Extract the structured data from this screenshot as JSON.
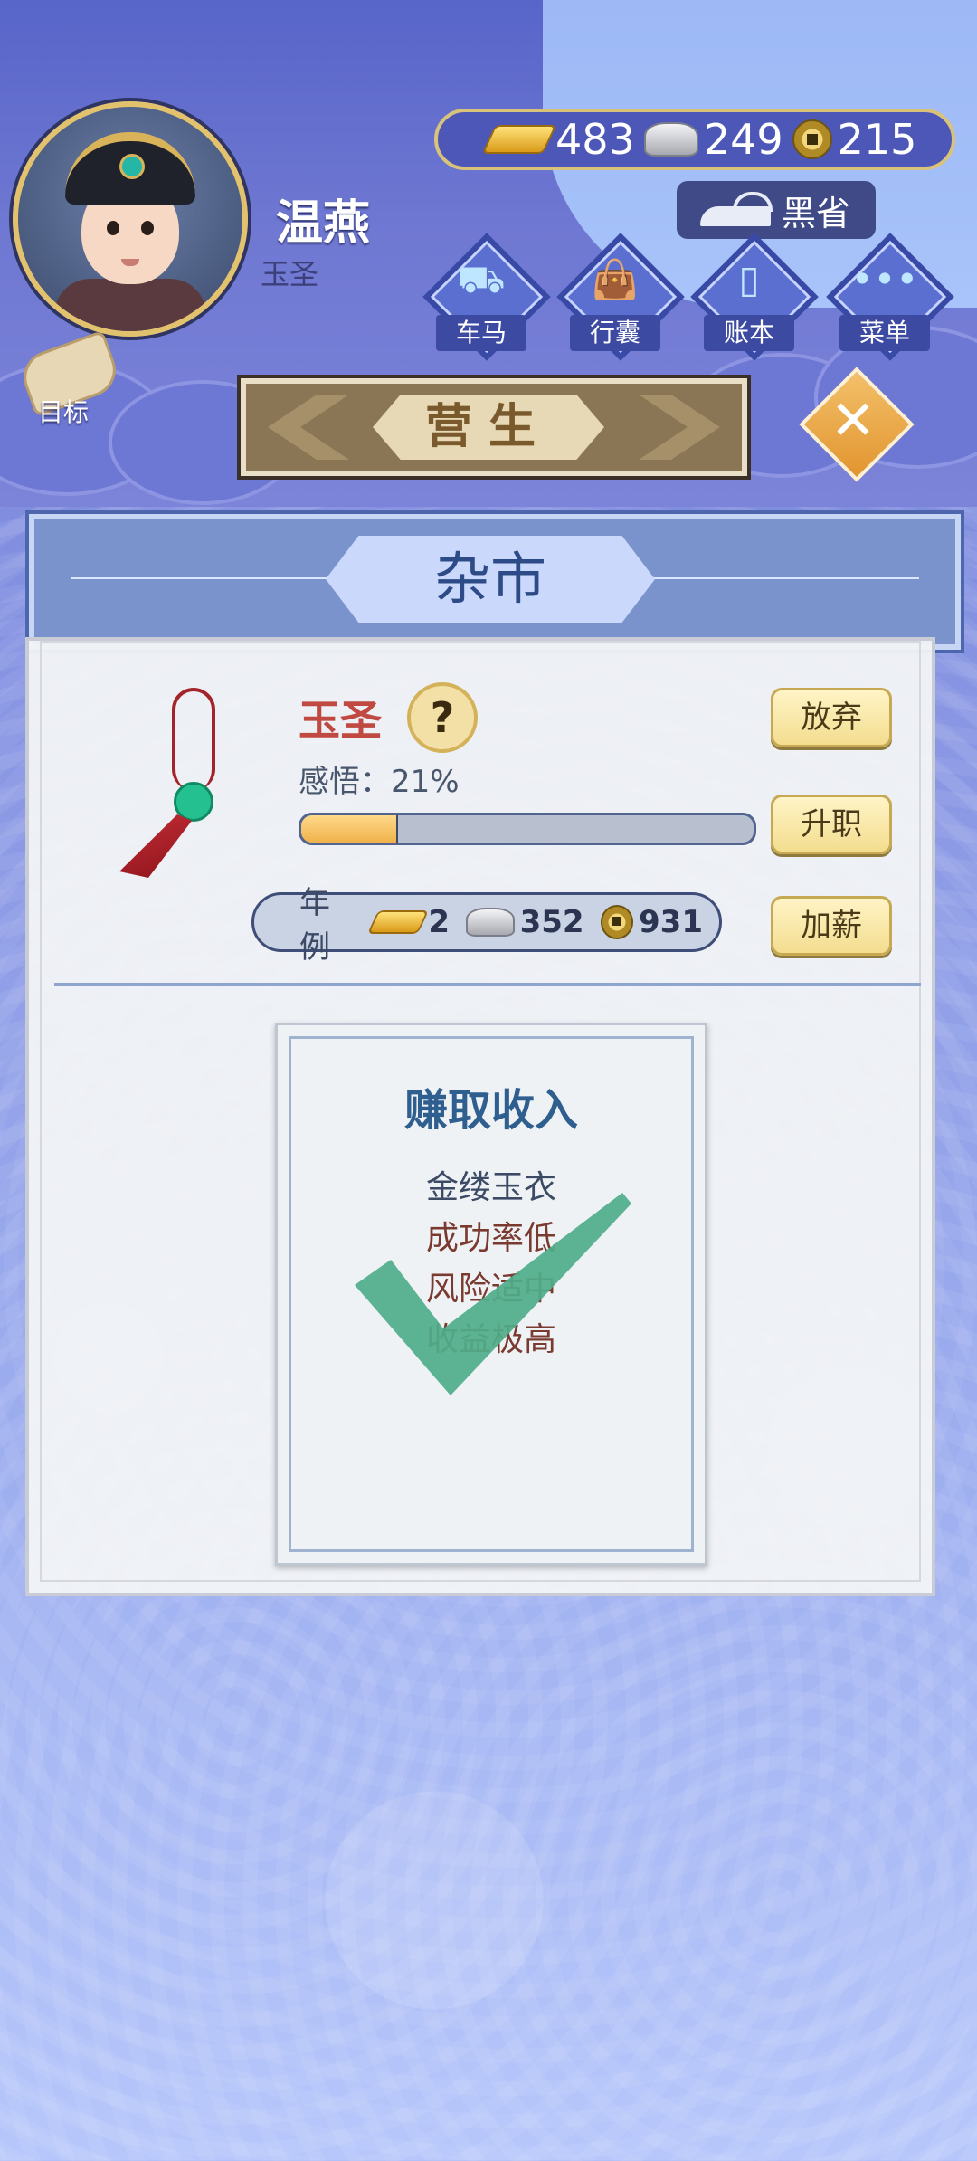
{
  "player": {
    "name": "温燕",
    "rank": "玉圣"
  },
  "currency": {
    "gold": "483",
    "silver": "249",
    "coins": "215"
  },
  "shop_button": {
    "label": "黑省"
  },
  "menu": [
    {
      "label": "车马",
      "icon": "carriage-icon"
    },
    {
      "label": "行囊",
      "icon": "bag-icon"
    },
    {
      "label": "账本",
      "icon": "ledger-icon"
    },
    {
      "label": "菜单",
      "icon": "more-icon"
    }
  ],
  "goal": {
    "label": "目标"
  },
  "banner": {
    "title": "营生"
  },
  "panel": {
    "title": "杂市"
  },
  "job": {
    "name": "玉圣",
    "help": "?",
    "insight_text": "感悟：21%",
    "insight_fraction": 0.21,
    "buttons": {
      "quit": "放弃",
      "promote": "升职",
      "raise": "加薪"
    }
  },
  "salary": {
    "label": "年例",
    "gold": "2",
    "silver": "352",
    "coins": "931"
  },
  "task": {
    "title": "赚取收入",
    "lines": [
      "金缕玉衣",
      "成功率低",
      "风险适中",
      "收益极高"
    ],
    "completed": true
  },
  "colors": {
    "accent": "#2f5f8e",
    "job_name": "#c04a42",
    "button": "#f3dd8f",
    "progress": "#f0b24a",
    "check": "#4fae8a"
  }
}
